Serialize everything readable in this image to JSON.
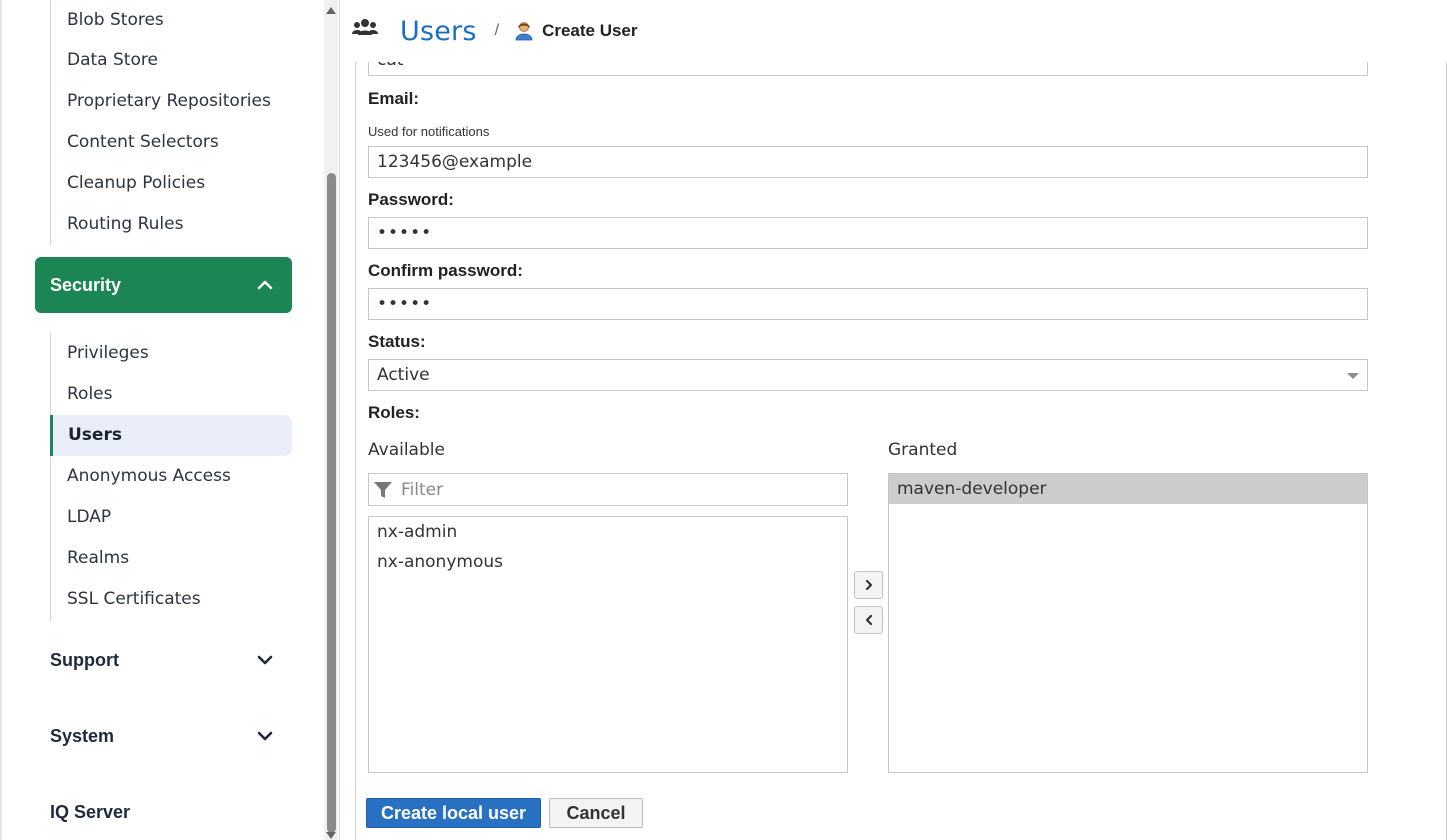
{
  "sidebar": {
    "top_items": [
      {
        "label": "Blob Stores"
      },
      {
        "label": "Data Store"
      },
      {
        "label": "Proprietary Repositories"
      },
      {
        "label": "Content Selectors"
      },
      {
        "label": "Cleanup Policies"
      },
      {
        "label": "Routing Rules"
      }
    ],
    "security": {
      "label": "Security",
      "items": [
        {
          "label": "Privileges"
        },
        {
          "label": "Roles"
        },
        {
          "label": "Users"
        },
        {
          "label": "Anonymous Access"
        },
        {
          "label": "LDAP"
        },
        {
          "label": "Realms"
        },
        {
          "label": "SSL Certificates"
        }
      ]
    },
    "support": {
      "label": "Support"
    },
    "system": {
      "label": "System"
    },
    "iq_server": {
      "label": "IQ Server"
    }
  },
  "header": {
    "title": "Users",
    "separator": "/",
    "crumb": "Create User"
  },
  "form": {
    "partial_field_value": "cat",
    "email": {
      "label": "Email:",
      "hint": "Used for notifications",
      "value": "123456@example"
    },
    "password": {
      "label": "Password:",
      "value": "•••••"
    },
    "confirm_password": {
      "label": "Confirm password:",
      "value": "•••••"
    },
    "status": {
      "label": "Status:",
      "value": "Active"
    },
    "roles": {
      "label": "Roles:",
      "available_label": "Available",
      "granted_label": "Granted",
      "filter_placeholder": "Filter",
      "available": [
        "nx-admin",
        "nx-anonymous"
      ],
      "granted": [
        "maven-developer"
      ]
    },
    "create_button": "Create local user",
    "cancel_button": "Cancel"
  },
  "colors": {
    "accent_green": "#1b8554",
    "brand_blue": "#1b6fc2",
    "primary_button": "#2770c2"
  },
  "icons": {
    "header_section": "users-icon",
    "crumb": "user-icon",
    "filter": "filter-icon",
    "expand": "chevron-down-icon",
    "collapse": "chevron-up-icon"
  }
}
